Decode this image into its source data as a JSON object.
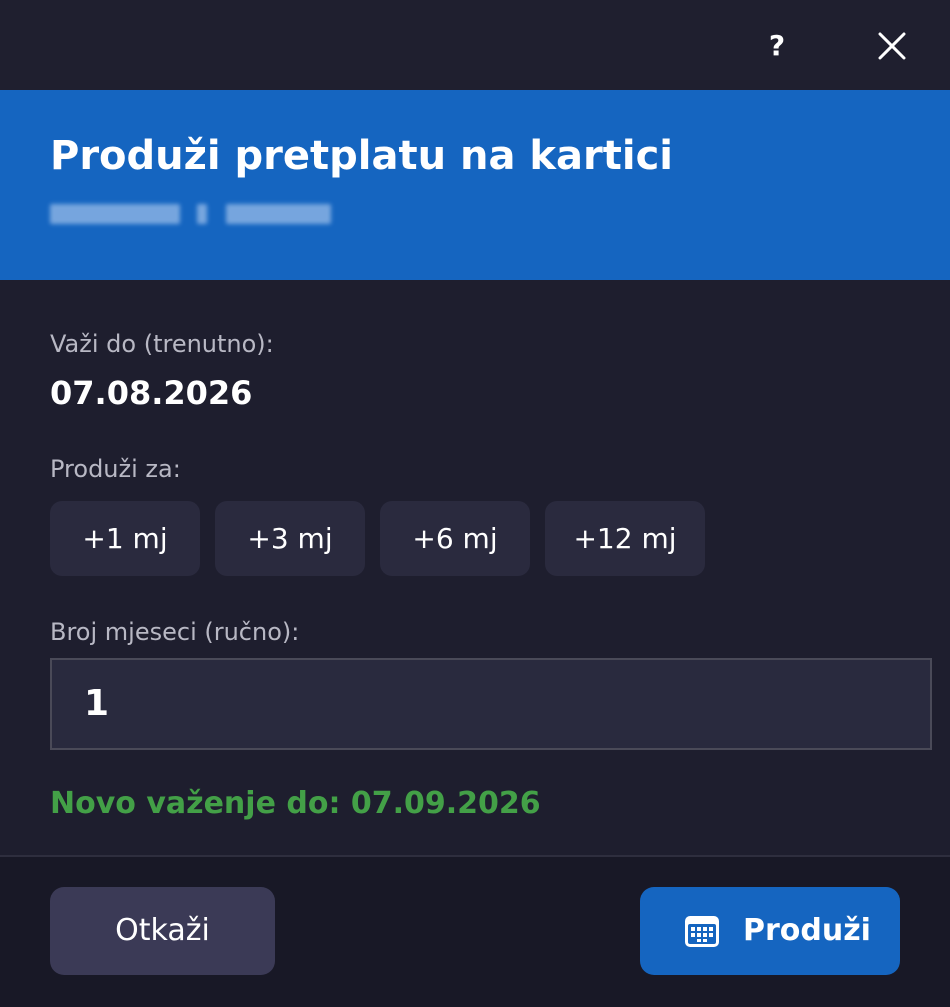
{
  "titlebar": {
    "help_label": "?",
    "help_icon": "question-mark-icon",
    "close_icon": "close-icon"
  },
  "header": {
    "title": "Produži pretplatu na kartici",
    "subtitle_redacted": true
  },
  "current": {
    "label": "Važi do (trenutno):",
    "value": "07.08.2026"
  },
  "extend": {
    "label": "Produži za:",
    "options": [
      "+1 mj",
      "+3 mj",
      "+6 mj",
      "+12 mj"
    ]
  },
  "manual": {
    "label": "Broj mjeseci (ručno):",
    "value": "1"
  },
  "result": {
    "text": "Novo važenje do: 07.09.2026"
  },
  "footer": {
    "cancel_label": "Otkaži",
    "confirm_label": "Produži",
    "confirm_icon": "calendar-icon"
  },
  "colors": {
    "background": "#1e1e2e",
    "header": "#1565c0",
    "success": "#43a047",
    "chip": "#2a2a3e",
    "cancel": "#3b3a56"
  }
}
